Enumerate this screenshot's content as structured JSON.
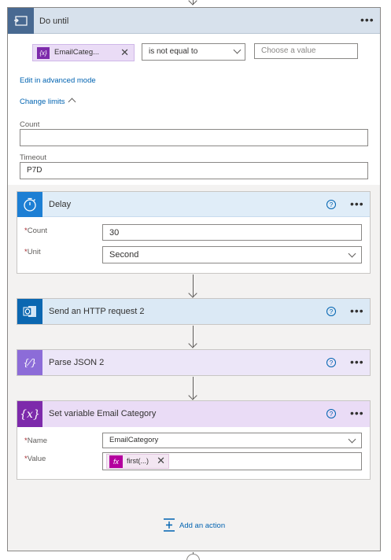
{
  "do_until": {
    "title": "Do until",
    "condition": {
      "token_label": "EmailCateg...",
      "operator": "is not equal to",
      "value_placeholder": "Choose a value"
    },
    "edit_advanced_label": "Edit in advanced mode",
    "change_limits_label": "Change limits",
    "count_label": "Count",
    "count_value": "",
    "timeout_label": "Timeout",
    "timeout_value": "P7D"
  },
  "actions": {
    "delay": {
      "title": "Delay",
      "count_label": "Count",
      "count_value": "30",
      "unit_label": "Unit",
      "unit_value": "Second"
    },
    "http": {
      "title": "Send an HTTP request 2"
    },
    "parse": {
      "title": "Parse JSON 2"
    },
    "setvar": {
      "title": "Set variable Email Category",
      "name_label": "Name",
      "name_value": "EmailCategory",
      "value_label": "Value",
      "value_token": "first(...)"
    }
  },
  "add_action_label": "Add an action",
  "required_marker": "*",
  "help_glyph": "?",
  "more_glyph": "•••",
  "colors": {
    "do_until_icon_bg": "#486991",
    "delay_accent": "#1d7fd4",
    "http_accent": "#0b67b1",
    "parse_accent": "#8c6cd8",
    "setvar_accent": "#7d2aab",
    "link": "#0063b1"
  },
  "icons": {
    "do_until": "loop-icon",
    "delay": "timer-icon",
    "http": "outlook-icon",
    "parse": "variable-braces-icon",
    "setvar": "variable-x-icon"
  }
}
